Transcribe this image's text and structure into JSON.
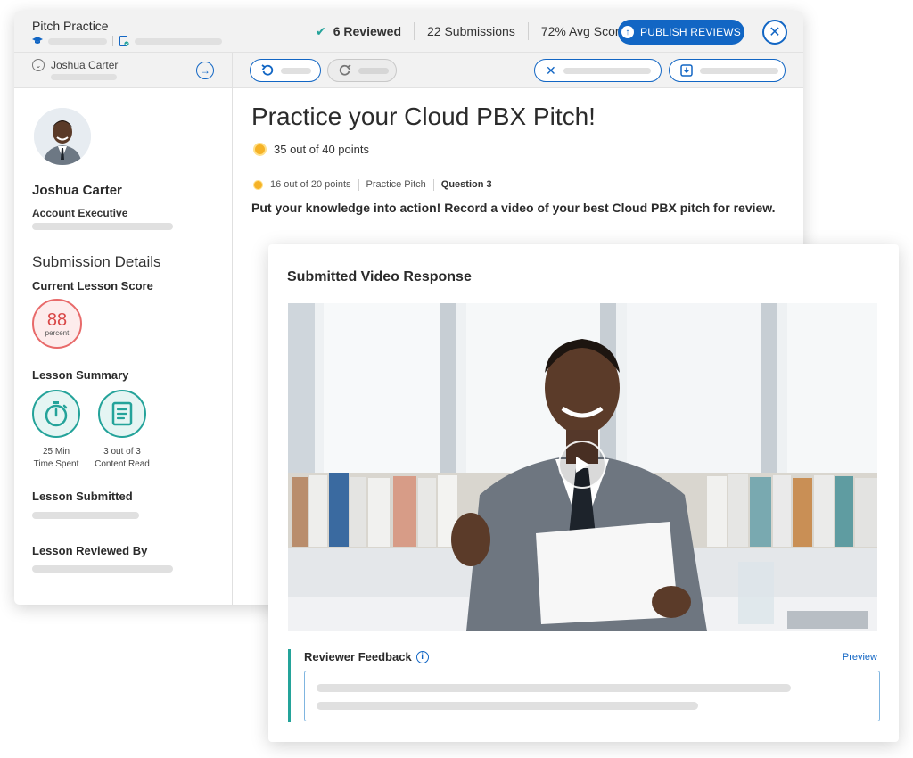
{
  "header": {
    "app_title": "Pitch Practice",
    "stats": {
      "reviewed": "6 Reviewed",
      "submissions": "22 Submissions",
      "avg_score": "72% Avg Score"
    },
    "publish_label": "PUBLISH REVIEWS"
  },
  "sidebar": {
    "selected_user": "Joshua Carter",
    "profile": {
      "name": "Joshua Carter",
      "role": "Account Executive"
    },
    "section_title": "Submission Details",
    "current_score_label": "Current Lesson Score",
    "score": {
      "value": "88",
      "unit": "percent"
    },
    "summary_label": "Lesson Summary",
    "summary": {
      "time_value": "25 Min",
      "time_label": "Time Spent",
      "content_value": "3 out of 3",
      "content_label": "Content Read"
    },
    "submitted_label": "Lesson Submitted",
    "reviewed_by_label": "Lesson Reviewed By"
  },
  "main": {
    "title": "Practice your Cloud PBX Pitch!",
    "total_points": "35 out of 40 points",
    "question_meta": {
      "points": "16 out of 20 points",
      "type": "Practice Pitch",
      "number": "Question 3"
    },
    "question_text": "Put your knowledge into action! Record a video of your best Cloud PBX pitch for review."
  },
  "video_card": {
    "title": "Submitted Video Response",
    "feedback_label": "Reviewer Feedback",
    "preview_label": "Preview"
  },
  "icons": {
    "check": "check-icon",
    "publish": "upload-icon",
    "close": "close-icon",
    "undo": "undo-icon",
    "redo": "redo-icon",
    "reject": "x-icon",
    "save": "download-icon",
    "timer": "stopwatch-icon",
    "content": "document-icon",
    "info": "info-icon",
    "play": "play-icon"
  },
  "colors": {
    "accent": "#1266c4",
    "teal": "#24a39a",
    "score_red": "#d94848",
    "coin": "#f5b226"
  }
}
